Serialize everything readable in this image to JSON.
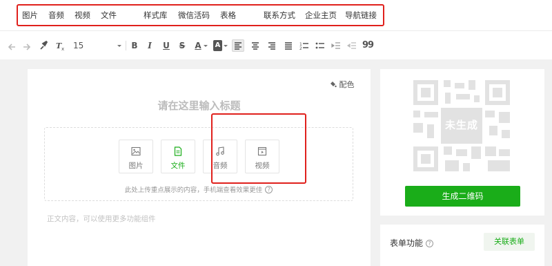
{
  "insert_bar": {
    "items": [
      "图片",
      "音频",
      "视频",
      "文件",
      "样式库",
      "微信活码",
      "表格",
      "联系方式",
      "企业主页",
      "导航链接"
    ]
  },
  "toolbar": {
    "font_size": "15",
    "letters": [
      "B",
      "I",
      "U",
      "S",
      "A",
      "A"
    ],
    "quote": "99",
    "icons": [
      "undo-icon",
      "redo-icon",
      "format-brush-icon",
      "clear-format-icon",
      "font-size-dropdown-icon",
      "align-left-icon",
      "align-center-icon",
      "align-right-icon",
      "align-justify-icon",
      "ordered-list-icon",
      "unordered-list-icon",
      "indent-icon",
      "outdent-icon",
      "quote-icon"
    ]
  },
  "editor": {
    "color_label": "配色",
    "title_placeholder": "请在这里输入标题",
    "cards": [
      {
        "label": "图片",
        "icon": "image-icon"
      },
      {
        "label": "文件",
        "icon": "file-icon"
      },
      {
        "label": "音频",
        "icon": "audio-icon"
      },
      {
        "label": "视频",
        "icon": "video-icon"
      }
    ],
    "upload_hint": "此处上传重点展示的内容，手机端查看效果更佳",
    "body_placeholder": "正文内容，可以使用更多功能组件"
  },
  "qr_panel": {
    "status": "未生成",
    "button": "生成二维码"
  },
  "form_panel": {
    "label": "表单功能",
    "button": "关联表单"
  },
  "colors": {
    "accent": "#1aad19",
    "highlight_red": "#e0201c"
  }
}
